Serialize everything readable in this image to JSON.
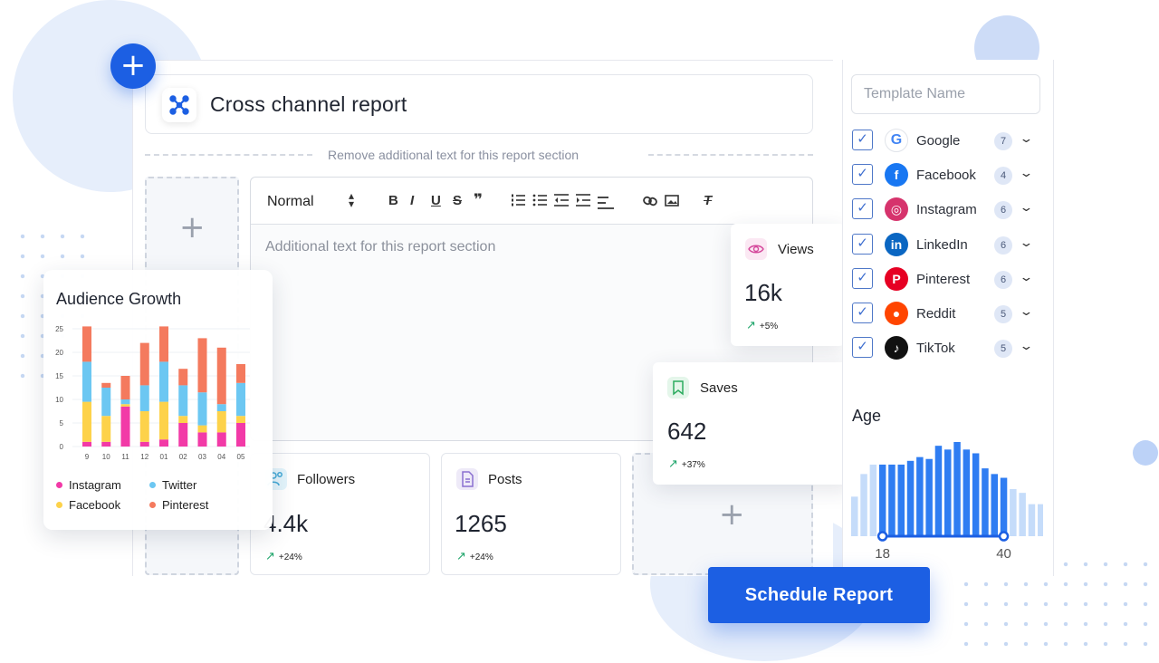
{
  "fab_label": "+",
  "report": {
    "title": "Cross channel report",
    "icon": "share-nodes-icon"
  },
  "section_hint": "Remove additional text for this report section",
  "editor": {
    "format_select": "Normal",
    "placeholder": "Additional text for this report section",
    "toolbar_tools": [
      "bold-icon",
      "italic-icon",
      "underline-icon",
      "strikethrough-icon",
      "quote-icon",
      "ordered-list-icon",
      "bullet-list-icon",
      "outdent-icon",
      "indent-icon",
      "align-icon",
      "link-icon",
      "image-icon",
      "clear-format-icon"
    ],
    "toolbar_glyphs": {
      "bold": "B",
      "italic": "I",
      "underline": "U",
      "strike": "S",
      "quote": "❞",
      "clear": "T"
    }
  },
  "add_glyph": "+",
  "stats": {
    "followers": {
      "label": "Followers",
      "value": "4.4k",
      "change": "+24%"
    },
    "posts": {
      "label": "Posts",
      "value": "1265",
      "change": "+24%"
    },
    "views": {
      "label": "Views",
      "value": "16k",
      "change": "+5%"
    },
    "saves": {
      "label": "Saves",
      "value": "642",
      "change": "+37%"
    }
  },
  "audience_growth": {
    "title": "Audience Growth",
    "legend": [
      "Instagram",
      "Twitter",
      "Facebook",
      "Pinterest"
    ]
  },
  "template": {
    "placeholder": "Template Name"
  },
  "channels": [
    {
      "name": "Google",
      "count": "7",
      "checked": true,
      "logo": "google-icon",
      "color": "#ffffff",
      "glyph": "G"
    },
    {
      "name": "Facebook",
      "count": "4",
      "checked": true,
      "logo": "facebook-icon",
      "color": "#1877f2",
      "glyph": "f"
    },
    {
      "name": "Instagram",
      "count": "6",
      "checked": true,
      "logo": "instagram-icon",
      "color": "#d6336c",
      "glyph": "◎"
    },
    {
      "name": "LinkedIn",
      "count": "6",
      "checked": true,
      "logo": "linkedin-icon",
      "color": "#0a66c2",
      "glyph": "in"
    },
    {
      "name": "Pinterest",
      "count": "6",
      "checked": true,
      "logo": "pinterest-icon",
      "color": "#e60023",
      "glyph": "P"
    },
    {
      "name": "Reddit",
      "count": "5",
      "checked": true,
      "logo": "reddit-icon",
      "color": "#ff4500",
      "glyph": "●"
    },
    {
      "name": "TikTok",
      "count": "5",
      "checked": true,
      "logo": "tiktok-icon",
      "color": "#111111",
      "glyph": "♪"
    }
  ],
  "age": {
    "title": "Age",
    "range_min": "18",
    "range_max": "40"
  },
  "schedule_button": "Schedule Report",
  "chart_data": [
    {
      "type": "bar",
      "stacked": true,
      "title": "Audience Growth",
      "categories": [
        "9",
        "10",
        "11",
        "12",
        "01",
        "02",
        "03",
        "04",
        "05"
      ],
      "ylim": [
        0,
        25
      ],
      "yticks": [
        0,
        5,
        10,
        15,
        20,
        25
      ],
      "grid": true,
      "legend_position": "bottom",
      "colors": {
        "Instagram": "#f23aa7",
        "Facebook": "#fdd24a",
        "Twitter": "#6cc7f2",
        "Pinterest": "#f47a5e"
      },
      "series": [
        {
          "name": "Instagram",
          "values": [
            1,
            1,
            8.5,
            1,
            1.5,
            5,
            3,
            3,
            5
          ]
        },
        {
          "name": "Facebook",
          "values": [
            8.5,
            5.5,
            0.5,
            6.5,
            8,
            1.5,
            1.5,
            4.5,
            1.5
          ]
        },
        {
          "name": "Twitter",
          "values": [
            8.5,
            6,
            1,
            5.5,
            8.5,
            6.5,
            7,
            1.5,
            7
          ]
        },
        {
          "name": "Pinterest",
          "values": [
            7.5,
            1,
            5,
            9,
            7.5,
            3.5,
            11.5,
            12,
            4
          ]
        }
      ]
    },
    {
      "type": "bar",
      "title": "Age",
      "categories": [
        "b1",
        "b2",
        "b3",
        "b4",
        "b5",
        "b6",
        "b7",
        "b8",
        "b9",
        "b10",
        "b11",
        "b12",
        "b13",
        "b14",
        "b15",
        "b16",
        "b17",
        "b18",
        "b19",
        "b20",
        "b21"
      ],
      "values": [
        42,
        66,
        76,
        76,
        76,
        76,
        80,
        84,
        82,
        96,
        92,
        100,
        92,
        88,
        72,
        66,
        62,
        50,
        46,
        34,
        34
      ],
      "selected_range": [
        "18",
        "40"
      ],
      "highlight_from_index": 3,
      "highlight_to_index": 16,
      "color_active": "#2f7df2",
      "color_inactive": "#c5dcfa"
    }
  ]
}
